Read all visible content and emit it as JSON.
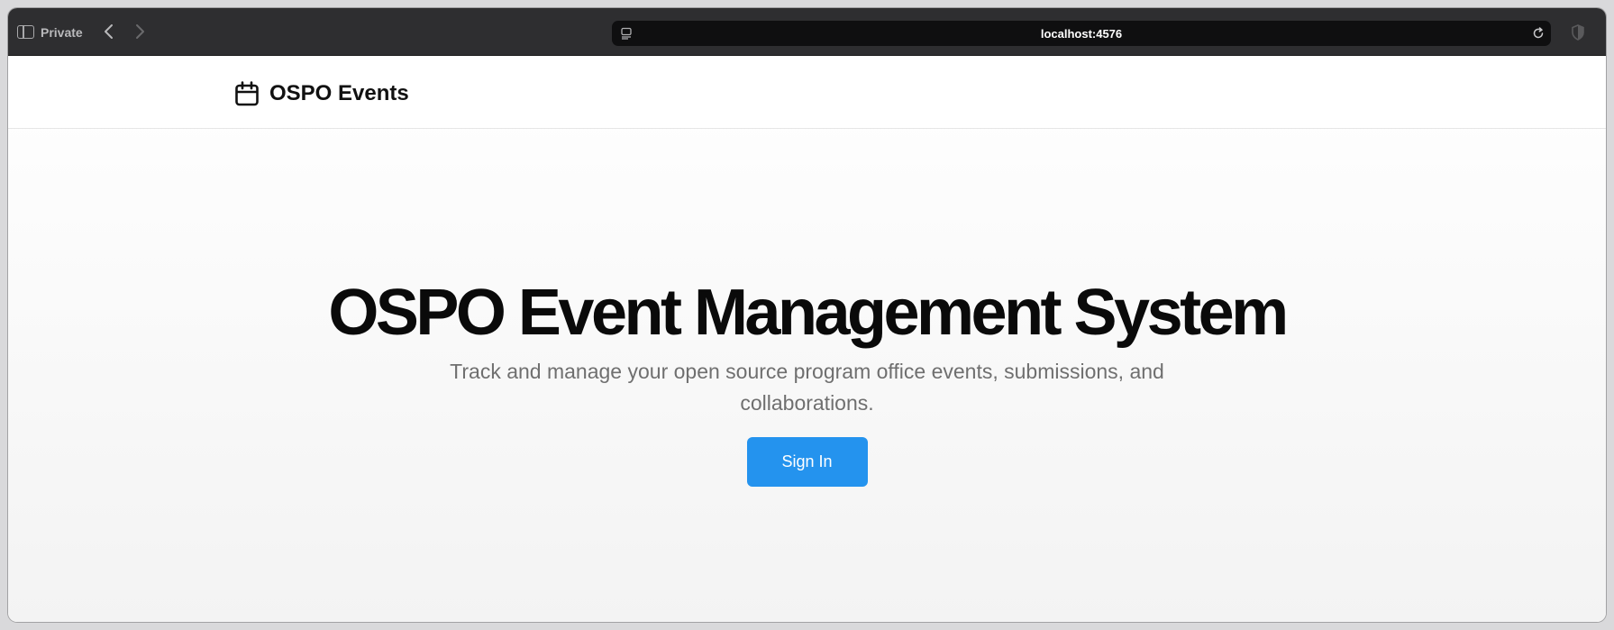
{
  "browser": {
    "private_label": "Private",
    "url": "localhost:4576"
  },
  "header": {
    "brand_icon": "calendar-icon",
    "brand_name": "OSPO Events"
  },
  "hero": {
    "title": "OSPO Event Management System",
    "subtitle": "Track and manage your open source program office events, submissions, and collaborations.",
    "signin_label": "Sign In"
  },
  "colors": {
    "accent": "#2493ee",
    "chrome": "#2e2e30",
    "url_bar": "#0f0f10"
  }
}
